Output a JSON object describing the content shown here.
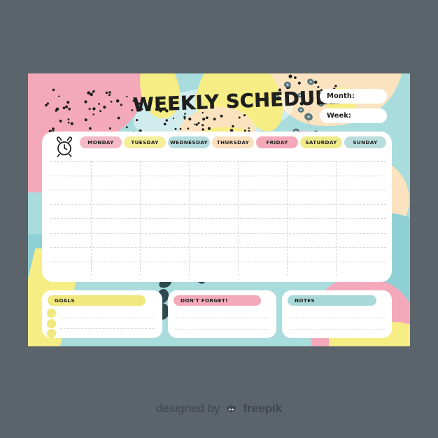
{
  "page": {
    "background_color": "#5b646b"
  },
  "card": {
    "background_color": "#a9dcdc",
    "title": "WEEKLY SCHEDULE",
    "fields": [
      {
        "name": "month",
        "label": "Month:",
        "value": ""
      },
      {
        "name": "week",
        "label": "Week:",
        "value": ""
      }
    ],
    "clock_icon": "alarm-clock-icon",
    "days": [
      {
        "label": "MONDAY",
        "color": "#f4b9c7"
      },
      {
        "label": "TUESDAY",
        "color": "#f5eE9a"
      },
      {
        "label": "WEDNESDAY",
        "color": "#b6ddde"
      },
      {
        "label": "THURSDAY",
        "color": "#fbe0bd"
      },
      {
        "label": "FRIDAY",
        "color": "#f4a9bb"
      },
      {
        "label": "SATURDAY",
        "color": "#f0eb8a"
      },
      {
        "label": "SUNDAY",
        "color": "#b9dcdd"
      }
    ],
    "grid": {
      "rows": 8,
      "columns": 7,
      "line_style": "dashed",
      "line_color": "#d8d3d3"
    },
    "boxes": [
      {
        "name": "goals",
        "title": "GOALS",
        "title_color": "#f0e87c",
        "bullets": 3,
        "bullet_color": "#f0e87c",
        "lines": 2
      },
      {
        "name": "dont-forget",
        "title": "DON'T FORGET!",
        "title_color": "#f4a9bb",
        "bullets": 0,
        "lines": 2
      },
      {
        "name": "notes",
        "title": "NOTES",
        "title_color": "#a9d8d8",
        "bullets": 0,
        "lines": 2
      }
    ]
  },
  "footer": {
    "designed_by": "designed by",
    "brand": "freepik",
    "logo": "freepik-crown-logo"
  }
}
